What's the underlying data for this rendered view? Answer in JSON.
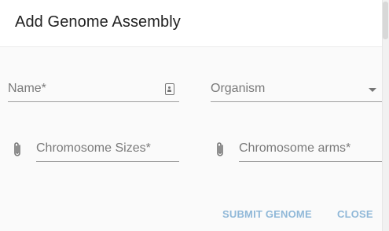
{
  "dialog": {
    "title": "Add Genome Assembly"
  },
  "form": {
    "name_label": "Name*",
    "organism_label": "Organism",
    "chromosome_sizes_label": "Chromosome Sizes*",
    "chromosome_arms_label": "Chromosome arms*"
  },
  "actions": {
    "submit_label": "SUBMIT GENOME",
    "close_label": "CLOSE"
  },
  "icons": {
    "name_field": "contact-badge-icon",
    "organism_field": "dropdown-caret-icon",
    "chromosome_sizes": "paperclip-icon",
    "chromosome_arms": "paperclip-icon"
  },
  "colors": {
    "action_text": "#90b8d8",
    "underline": "#9e9e9e",
    "label": "#7a7a7a"
  }
}
